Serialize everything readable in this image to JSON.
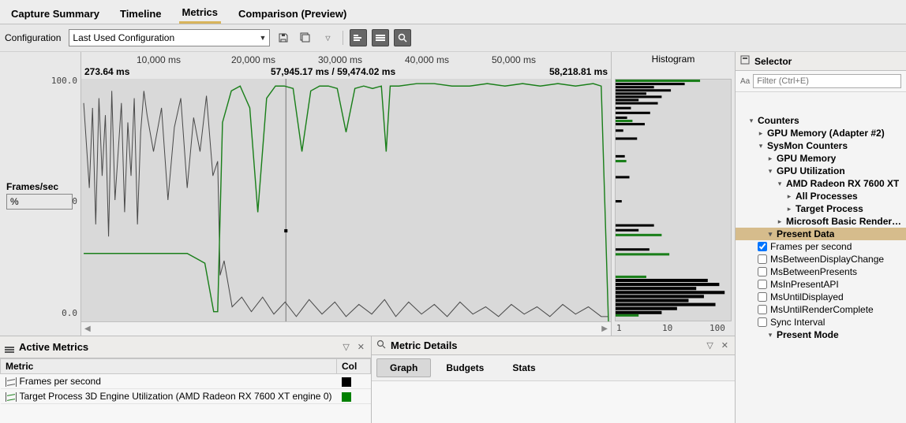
{
  "tabs": {
    "capture_summary": "Capture Summary",
    "timeline": "Timeline",
    "metrics": "Metrics",
    "comparison": "Comparison (Preview)"
  },
  "config": {
    "label": "Configuration",
    "selected": "Last Used Configuration"
  },
  "chart": {
    "y": {
      "top": "100.0",
      "mid": "50.0",
      "bot": "0.0"
    },
    "x_ticks": {
      "t1": "10,000 ms",
      "t2": "20,000 ms",
      "t3": "30,000 ms",
      "t4": "40,000 ms",
      "t5": "50,000 ms"
    },
    "stamps": {
      "left": "273.64 ms",
      "mid": "57,945.17 ms / 59,474.02 ms",
      "right": "58,218.81 ms"
    },
    "frames_label": "Frames/sec",
    "frames_value": "%"
  },
  "histogram": {
    "title": "Histogram",
    "x": {
      "a": "1",
      "b": "10",
      "c": "100"
    }
  },
  "active_metrics": {
    "title": "Active Metrics",
    "col_metric": "Metric",
    "col_col": "Col",
    "rows": {
      "r1": {
        "label": "Frames per second",
        "color": "#000000"
      },
      "r2": {
        "label": "Target Process 3D Engine Utilization (AMD Radeon RX 7600 XT engine 0)",
        "color": "#008000"
      }
    }
  },
  "metric_details": {
    "title": "Metric Details",
    "tabs": {
      "graph": "Graph",
      "budgets": "Budgets",
      "stats": "Stats"
    }
  },
  "selector": {
    "title": "Selector",
    "filter_placeholder": "Filter (Ctrl+E)",
    "tree": {
      "counters": "Counters",
      "gpu_mem_adapter": "GPU Memory (Adapter #2)",
      "sysmon": "SysMon Counters",
      "gpu_memory": "GPU Memory",
      "gpu_util": "GPU Utilization",
      "amd_radeon": "AMD Radeon RX 7600 XT",
      "all_proc": "All Processes",
      "target_proc": "Target Process",
      "ms_basic": "Microsoft Basic Render Driver",
      "present_data": "Present Data",
      "fps": "Frames per second",
      "ms_between_disp": "MsBetweenDisplayChange",
      "ms_between_pres": "MsBetweenPresents",
      "ms_in_present": "MsInPresentAPI",
      "ms_until_disp": "MsUntilDisplayed",
      "ms_until_render": "MsUntilRenderComplete",
      "sync_interval": "Sync Interval",
      "present_mode": "Present Mode"
    }
  },
  "chart_data": {
    "type": "line",
    "x_unit": "ms",
    "x_range": [
      0,
      60000
    ],
    "y_range": [
      0,
      100
    ],
    "ylabel": "Frames/sec  /  %",
    "series": [
      {
        "name": "Frames per second",
        "color": "#4a4a4a",
        "x": [
          274,
          1000,
          1500,
          2000,
          2500,
          3000,
          3500,
          4000,
          4500,
          5000,
          5500,
          6000,
          6500,
          7000,
          7500,
          8000,
          8500,
          9000,
          9500,
          10000,
          11000,
          12000,
          13000,
          14000,
          15000,
          15500,
          16000,
          17000,
          18000,
          19000,
          20000,
          22000,
          24000,
          26000,
          28000,
          30000,
          32000,
          34000,
          36000,
          38000,
          40000,
          42000,
          44000,
          46000,
          48000,
          50000,
          52000,
          54000,
          56000,
          58000,
          58218
        ],
        "values": [
          90,
          55,
          88,
          40,
          92,
          60,
          85,
          35,
          95,
          50,
          70,
          90,
          45,
          82,
          60,
          92,
          40,
          78,
          95,
          85,
          70,
          95,
          65,
          90,
          66,
          19,
          25,
          6,
          10,
          4,
          10,
          3,
          9,
          2,
          8,
          3,
          9,
          2,
          7,
          3,
          8,
          2,
          7,
          3,
          8,
          2,
          6,
          3,
          7,
          2,
          2
        ]
      },
      {
        "name": "Target Process 3D Engine Utilization (AMD Radeon RX 7600 XT engine 0)",
        "color": "#1a7f1a",
        "x": [
          274,
          2000,
          4000,
          6000,
          8000,
          10000,
          12000,
          13000,
          14000,
          15000,
          15500,
          16000,
          17000,
          18000,
          19000,
          20000,
          21000,
          22000,
          23000,
          24000,
          25000,
          26000,
          27000,
          28000,
          29000,
          30000,
          31000,
          32000,
          33000,
          34000,
          34500,
          35000,
          36000,
          38000,
          40000,
          42000,
          44000,
          46000,
          48000,
          50000,
          52000,
          54000,
          56000,
          58000,
          58218
        ],
        "values": [
          28,
          28,
          28,
          28,
          28,
          28,
          28,
          26,
          24,
          4,
          4,
          82,
          95,
          97,
          88,
          45,
          92,
          97,
          97,
          96,
          70,
          95,
          97,
          97,
          96,
          78,
          96,
          97,
          96,
          97,
          70,
          97,
          97,
          98,
          98,
          97,
          97,
          98,
          97,
          98,
          97,
          98,
          97,
          97,
          0
        ]
      }
    ],
    "x_ticks": [
      10000,
      20000,
      30000,
      40000,
      50000
    ],
    "cursors": {
      "span_start_ms": 57945.17,
      "span_end_ms": 59474.02,
      "origin_ms": 273.64,
      "right_edge_ms": 58218.81
    }
  }
}
